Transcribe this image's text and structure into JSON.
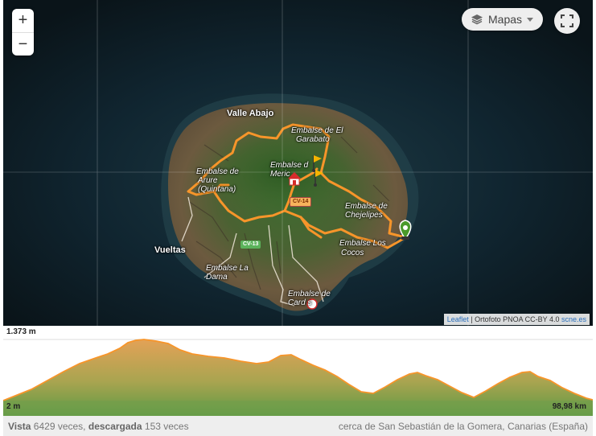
{
  "map": {
    "zoom_in": "+",
    "zoom_out": "−",
    "layer_label": "Mapas",
    "attribution_link_1": "Leaflet",
    "attribution_text": " | Ortofoto PNOA CC-BY 4.0 ",
    "attribution_link_2": "scne.es",
    "labels": {
      "valle_abajo": "Valle Abajo",
      "vueltas": "Vueltas",
      "garabato_1": "Embalse de El",
      "garabato_2": "Garabato",
      "merica_1": "Embalse d",
      "merica_2": "Meric",
      "arure_1": "Embalse de",
      "arure_2": "Arure",
      "arure_3": "(Quintana)",
      "chejelipes_1": "Embalse de",
      "chejelipes_2": "Chejelipes",
      "cocos_1": "Embalse Los",
      "cocos_2": "Cocos",
      "dama_1": "Embalse La",
      "dama_2": "Dama",
      "cardones_1": "Embalse de",
      "cardones_2": "Card     s"
    },
    "roads": {
      "cv14": "CV-14",
      "cv13": "CV-13"
    },
    "colors": {
      "track": "#f7952a",
      "marker": "#4a9a2a"
    },
    "icons": [
      "layers-icon",
      "caret-down-icon",
      "fullscreen-icon",
      "start-marker-icon",
      "flag-icon",
      "shelter-icon",
      "compass-icon"
    ]
  },
  "profile": {
    "max_elev_label": "1.373 m",
    "min_elev_label": "2 m",
    "distance_label": "98,98 km",
    "colors": {
      "line": "#f7952a",
      "fill_top": "#e9a85a",
      "fill_bottom": "#5f9a44"
    }
  },
  "footer": {
    "views_label": "Vista",
    "views_count": " 6429 veces, ",
    "downloads_label": "descargada",
    "downloads_count": " 153 veces",
    "location": "cerca de San Sebastián de la Gomera, Canarias (España)"
  }
}
